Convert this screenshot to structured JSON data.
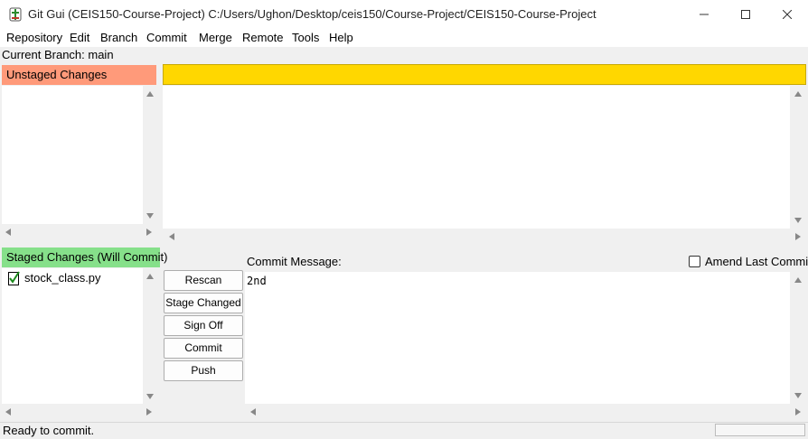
{
  "window": {
    "title": "Git Gui (CEIS150-Course-Project) C:/Users/Ughon/Desktop/ceis150/Course-Project/CEIS150-Course-Project",
    "app_icon": "git-gui-icon",
    "controls": [
      "minimize-icon",
      "maximize-icon",
      "close-icon"
    ]
  },
  "menu": [
    "Repository",
    "Edit",
    "Branch",
    "Commit",
    "Merge",
    "Remote",
    "Tools",
    "Help"
  ],
  "branch": {
    "text": "Current Branch: main"
  },
  "unstaged": {
    "header": "Unstaged Changes",
    "header_color": "#ff9a7a",
    "files": []
  },
  "staged": {
    "header": "Staged Changes (Will Commit)",
    "header_color": "#86e08a",
    "files": [
      {
        "name": "stock_class.py",
        "icon": "staged-file-check-icon"
      }
    ]
  },
  "diff": {
    "header_color": "#ffd700"
  },
  "buttons": {
    "rescan": "Rescan",
    "stage_changed": "Stage Changed",
    "sign_off": "Sign Off",
    "commit": "Commit",
    "push": "Push"
  },
  "commit": {
    "label": "Commit Message:",
    "amend_label": "Amend Last Commit",
    "amend_checked": false,
    "message": "2nd"
  },
  "status": {
    "text": "Ready to commit."
  }
}
